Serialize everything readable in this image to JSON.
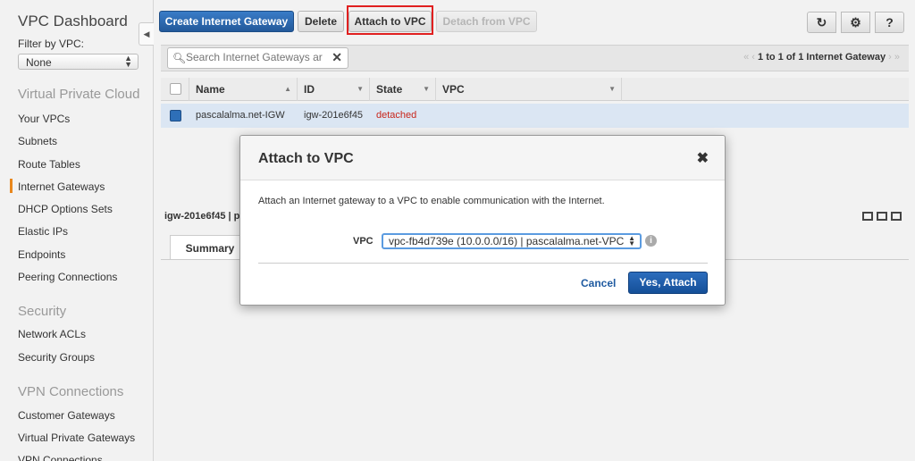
{
  "sidebar": {
    "title": "VPC Dashboard",
    "filter_label": "Filter by VPC:",
    "filter_value": "None",
    "sections": [
      {
        "label": "Virtual Private Cloud"
      },
      {
        "label": "Security"
      },
      {
        "label": "VPN Connections"
      }
    ],
    "items": [
      {
        "label": "Your VPCs"
      },
      {
        "label": "Subnets"
      },
      {
        "label": "Route Tables"
      },
      {
        "label": "Internet Gateways"
      },
      {
        "label": "DHCP Options Sets"
      },
      {
        "label": "Elastic IPs"
      },
      {
        "label": "Endpoints"
      },
      {
        "label": "Peering Connections"
      },
      {
        "label": "Network ACLs"
      },
      {
        "label": "Security Groups"
      },
      {
        "label": "Customer Gateways"
      },
      {
        "label": "Virtual Private Gateways"
      },
      {
        "label": "VPN Connections"
      }
    ],
    "active_item": "Internet Gateways"
  },
  "toolbar": {
    "create_label": "Create Internet Gateway",
    "delete_label": "Delete",
    "attach_label": "Attach to VPC",
    "detach_label": "Detach from VPC"
  },
  "icons": {
    "refresh": "refresh-icon",
    "settings": "gear-icon",
    "help": "help-icon"
  },
  "search": {
    "placeholder": "Search Internet Gateways ar"
  },
  "pagination": {
    "text": "1 to 1 of 1 Internet Gateway"
  },
  "table": {
    "columns": [
      "Name",
      "ID",
      "State",
      "VPC"
    ],
    "rows": [
      {
        "name": "pascalalma.net-IGW",
        "id": "igw-201e6f45",
        "state": "detached",
        "vpc": ""
      }
    ]
  },
  "detail": {
    "id_text": "igw-201e6f45 | p",
    "tab_summary": "Summary"
  },
  "modal": {
    "title": "Attach to VPC",
    "close": "✖",
    "description": "Attach an Internet gateway to a VPC to enable communication with the Internet.",
    "vpc_label": "VPC",
    "vpc_value": "vpc-fb4d739e (10.0.0.0/16) | pascalalma.net-VPC",
    "cancel_label": "Cancel",
    "confirm_label": "Yes, Attach"
  },
  "colors": {
    "primary": "#22599a",
    "highlight": "#e02020",
    "detached": "#c8261b",
    "active_marker": "#e9871d"
  }
}
